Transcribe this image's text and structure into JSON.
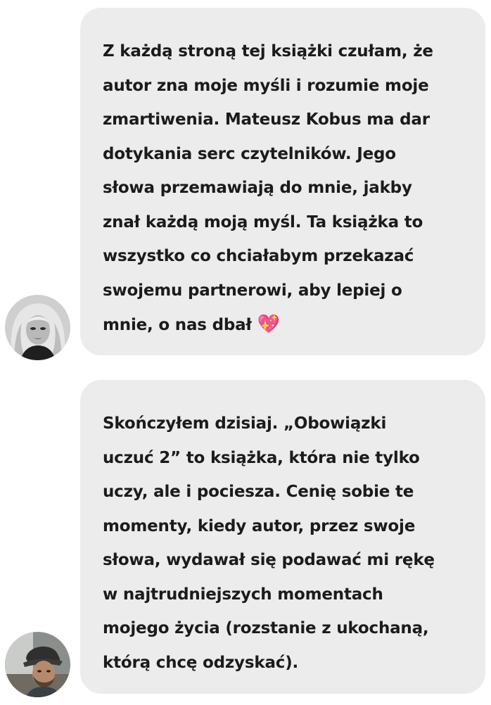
{
  "messages": [
    {
      "text": "Z każdą stroną tej książki czułam, że\nautor zna moje myśli i rozumie moje\nzmartiwenia. Mateusz Kobus ma dar\ndotykania serc czytelników. Jego\nsłowa przemawiają do mnie, jakby\nznał każdą moją myśl. Ta książka to\nwszystko co chciałabym przekazać\nswojemu partnerowi, aby lepiej o\nmnie, o nas dbał",
      "emoji": "💖",
      "avatar_icon": "woman-avatar"
    },
    {
      "text": "Skończyłem dzisiaj. „Obowiązki\nuczuć 2” to książka, która nie tylko\nuczy, ale i pociesza. Cenię sobie te\nmomenty, kiedy autor, przez swoje\nsłowa, wydawał się podawać mi rękę\nw najtrudniejszych momentach\nmojego życia (rozstanie z ukochaną,\nktórą chcę odzyskać).",
      "emoji": "",
      "avatar_icon": "man-avatar"
    }
  ],
  "colors": {
    "bubble_background": "#ececec",
    "text": "#1b1b1b",
    "page_background": "#ffffff"
  }
}
